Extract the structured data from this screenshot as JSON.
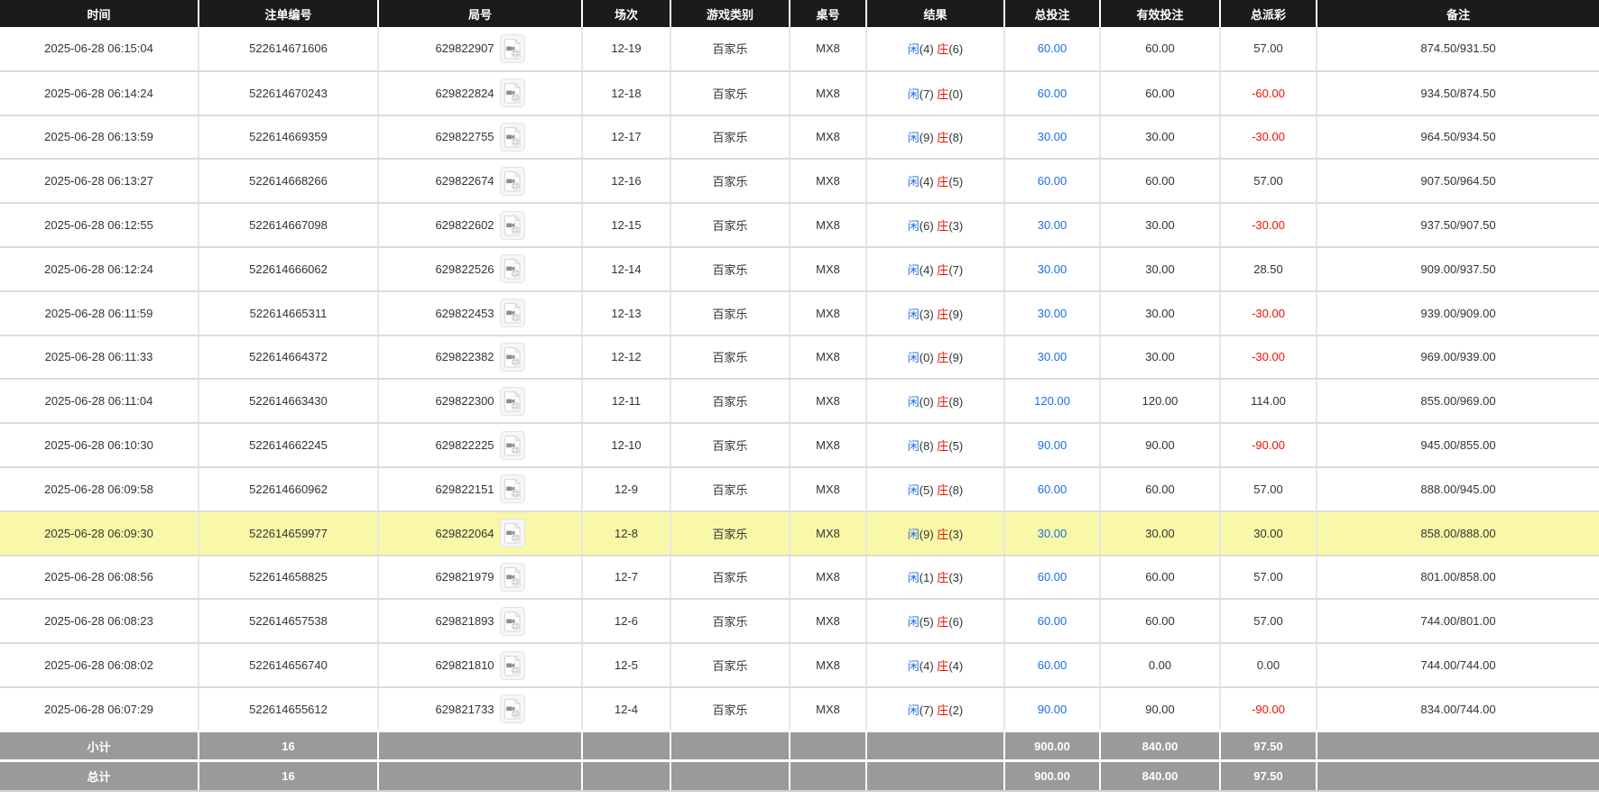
{
  "table": {
    "columns": [
      "时间",
      "注单编号",
      "局号",
      "场次",
      "游戏类别",
      "桌号",
      "结果",
      "总投注",
      "有效投注",
      "总派彩",
      "备注"
    ],
    "rows": [
      {
        "time": "2025-06-28 06:15:04",
        "order_no": "522614671606",
        "round_no": "629822907",
        "session": "12-19",
        "game": "百家乐",
        "table_no": "MX8",
        "result": {
          "player_label": "闲",
          "player_score": "(4)",
          "banker_label": "庄",
          "banker_score": "(6)"
        },
        "total_bet": "60.00",
        "valid_bet": "60.00",
        "payout": "57.00",
        "note": "874.50/931.50",
        "highlighted": false
      },
      {
        "time": "2025-06-28 06:14:24",
        "order_no": "522614670243",
        "round_no": "629822824",
        "session": "12-18",
        "game": "百家乐",
        "table_no": "MX8",
        "result": {
          "player_label": "闲",
          "player_score": "(7)",
          "banker_label": "庄",
          "banker_score": "(0)"
        },
        "total_bet": "60.00",
        "valid_bet": "60.00",
        "payout": "-60.00",
        "note": "934.50/874.50",
        "highlighted": false
      },
      {
        "time": "2025-06-28 06:13:59",
        "order_no": "522614669359",
        "round_no": "629822755",
        "session": "12-17",
        "game": "百家乐",
        "table_no": "MX8",
        "result": {
          "player_label": "闲",
          "player_score": "(9)",
          "banker_label": "庄",
          "banker_score": "(8)"
        },
        "total_bet": "30.00",
        "valid_bet": "30.00",
        "payout": "-30.00",
        "note": "964.50/934.50",
        "highlighted": false
      },
      {
        "time": "2025-06-28 06:13:27",
        "order_no": "522614668266",
        "round_no": "629822674",
        "session": "12-16",
        "game": "百家乐",
        "table_no": "MX8",
        "result": {
          "player_label": "闲",
          "player_score": "(4)",
          "banker_label": "庄",
          "banker_score": "(5)"
        },
        "total_bet": "60.00",
        "valid_bet": "60.00",
        "payout": "57.00",
        "note": "907.50/964.50",
        "highlighted": false
      },
      {
        "time": "2025-06-28 06:12:55",
        "order_no": "522614667098",
        "round_no": "629822602",
        "session": "12-15",
        "game": "百家乐",
        "table_no": "MX8",
        "result": {
          "player_label": "闲",
          "player_score": "(6)",
          "banker_label": "庄",
          "banker_score": "(3)"
        },
        "total_bet": "30.00",
        "valid_bet": "30.00",
        "payout": "-30.00",
        "note": "937.50/907.50",
        "highlighted": false
      },
      {
        "time": "2025-06-28 06:12:24",
        "order_no": "522614666062",
        "round_no": "629822526",
        "session": "12-14",
        "game": "百家乐",
        "table_no": "MX8",
        "result": {
          "player_label": "闲",
          "player_score": "(4)",
          "banker_label": "庄",
          "banker_score": "(7)"
        },
        "total_bet": "30.00",
        "valid_bet": "30.00",
        "payout": "28.50",
        "note": "909.00/937.50",
        "highlighted": false
      },
      {
        "time": "2025-06-28 06:11:59",
        "order_no": "522614665311",
        "round_no": "629822453",
        "session": "12-13",
        "game": "百家乐",
        "table_no": "MX8",
        "result": {
          "player_label": "闲",
          "player_score": "(3)",
          "banker_label": "庄",
          "banker_score": "(9)"
        },
        "total_bet": "30.00",
        "valid_bet": "30.00",
        "payout": "-30.00",
        "note": "939.00/909.00",
        "highlighted": false
      },
      {
        "time": "2025-06-28 06:11:33",
        "order_no": "522614664372",
        "round_no": "629822382",
        "session": "12-12",
        "game": "百家乐",
        "table_no": "MX8",
        "result": {
          "player_label": "闲",
          "player_score": "(0)",
          "banker_label": "庄",
          "banker_score": "(9)"
        },
        "total_bet": "30.00",
        "valid_bet": "30.00",
        "payout": "-30.00",
        "note": "969.00/939.00",
        "highlighted": false
      },
      {
        "time": "2025-06-28 06:11:04",
        "order_no": "522614663430",
        "round_no": "629822300",
        "session": "12-11",
        "game": "百家乐",
        "table_no": "MX8",
        "result": {
          "player_label": "闲",
          "player_score": "(0)",
          "banker_label": "庄",
          "banker_score": "(8)"
        },
        "total_bet": "120.00",
        "valid_bet": "120.00",
        "payout": "114.00",
        "note": "855.00/969.00",
        "highlighted": false
      },
      {
        "time": "2025-06-28 06:10:30",
        "order_no": "522614662245",
        "round_no": "629822225",
        "session": "12-10",
        "game": "百家乐",
        "table_no": "MX8",
        "result": {
          "player_label": "闲",
          "player_score": "(8)",
          "banker_label": "庄",
          "banker_score": "(5)"
        },
        "total_bet": "90.00",
        "valid_bet": "90.00",
        "payout": "-90.00",
        "note": "945.00/855.00",
        "highlighted": false
      },
      {
        "time": "2025-06-28 06:09:58",
        "order_no": "522614660962",
        "round_no": "629822151",
        "session": "12-9",
        "game": "百家乐",
        "table_no": "MX8",
        "result": {
          "player_label": "闲",
          "player_score": "(5)",
          "banker_label": "庄",
          "banker_score": "(8)"
        },
        "total_bet": "60.00",
        "valid_bet": "60.00",
        "payout": "57.00",
        "note": "888.00/945.00",
        "highlighted": false
      },
      {
        "time": "2025-06-28 06:09:30",
        "order_no": "522614659977",
        "round_no": "629822064",
        "session": "12-8",
        "game": "百家乐",
        "table_no": "MX8",
        "result": {
          "player_label": "闲",
          "player_score": "(9)",
          "banker_label": "庄",
          "banker_score": "(3)"
        },
        "total_bet": "30.00",
        "valid_bet": "30.00",
        "payout": "30.00",
        "note": "858.00/888.00",
        "highlighted": true
      },
      {
        "time": "2025-06-28 06:08:56",
        "order_no": "522614658825",
        "round_no": "629821979",
        "session": "12-7",
        "game": "百家乐",
        "table_no": "MX8",
        "result": {
          "player_label": "闲",
          "player_score": "(1)",
          "banker_label": "庄",
          "banker_score": "(3)"
        },
        "total_bet": "60.00",
        "valid_bet": "60.00",
        "payout": "57.00",
        "note": "801.00/858.00",
        "highlighted": false
      },
      {
        "time": "2025-06-28 06:08:23",
        "order_no": "522614657538",
        "round_no": "629821893",
        "session": "12-6",
        "game": "百家乐",
        "table_no": "MX8",
        "result": {
          "player_label": "闲",
          "player_score": "(5)",
          "banker_label": "庄",
          "banker_score": "(6)"
        },
        "total_bet": "60.00",
        "valid_bet": "60.00",
        "payout": "57.00",
        "note": "744.00/801.00",
        "highlighted": false
      },
      {
        "time": "2025-06-28 06:08:02",
        "order_no": "522614656740",
        "round_no": "629821810",
        "session": "12-5",
        "game": "百家乐",
        "table_no": "MX8",
        "result": {
          "player_label": "闲",
          "player_score": "(4)",
          "banker_label": "庄",
          "banker_score": "(4)"
        },
        "total_bet": "60.00",
        "valid_bet": "0.00",
        "payout": "0.00",
        "note": "744.00/744.00",
        "highlighted": false
      },
      {
        "time": "2025-06-28 06:07:29",
        "order_no": "522614655612",
        "round_no": "629821733",
        "session": "12-4",
        "game": "百家乐",
        "table_no": "MX8",
        "result": {
          "player_label": "闲",
          "player_score": "(7)",
          "banker_label": "庄",
          "banker_score": "(2)"
        },
        "total_bet": "90.00",
        "valid_bet": "90.00",
        "payout": "-90.00",
        "note": "834.00/744.00",
        "highlighted": false
      }
    ],
    "totals": [
      {
        "label": "小计",
        "count": "16",
        "total_bet": "900.00",
        "valid_bet": "840.00",
        "payout": "97.50"
      },
      {
        "label": "总计",
        "count": "16",
        "total_bet": "900.00",
        "valid_bet": "840.00",
        "payout": "97.50"
      }
    ]
  },
  "icons": {
    "round_video": "video-file-icon"
  },
  "colors": {
    "header_bg": "#1b1b1b",
    "accent_blue": "#1a6ee8",
    "negative_red": "#ee1100",
    "highlight_yellow": "#f8f8a8",
    "totals_gray": "#9a9a9a"
  }
}
